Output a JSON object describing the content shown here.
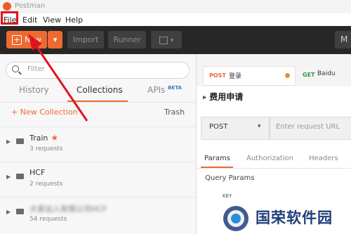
{
  "window": {
    "title": "Postman"
  },
  "menu": {
    "items": [
      "File",
      "Edit",
      "View",
      "Help"
    ]
  },
  "toolbar": {
    "new_label": "New",
    "import_label": "Import",
    "runner_label": "Runner"
  },
  "sidebar": {
    "filter_placeholder": "Filter",
    "tabs": [
      {
        "label": "History"
      },
      {
        "label": "Collections"
      },
      {
        "label": "APIs",
        "badge": "BETA"
      }
    ],
    "new_collection_label": "+ New Collection",
    "trash_label": "Trash",
    "collections": [
      {
        "name": "Train",
        "count": "3 requests",
        "starred": true
      },
      {
        "name": "HCF",
        "count": "2 requests"
      },
      {
        "name": "大家出入有限公司HCF",
        "count": "54 requests"
      }
    ]
  },
  "request_tabs": [
    {
      "method": "POST",
      "name": "登录"
    },
    {
      "method": "GET",
      "name": "Baidu"
    }
  ],
  "request": {
    "title": "费用申请",
    "method": "POST",
    "url_placeholder": "Enter request URL",
    "subtabs": [
      "Params",
      "Authorization",
      "Headers"
    ],
    "query_params_label": "Query Params",
    "key_label": "KEY"
  },
  "watermark": {
    "text": "国荣软件园"
  },
  "colors": {
    "accent": "#ef6a2f",
    "annotation": "#e1141e",
    "toolbar_bg": "#272727"
  }
}
